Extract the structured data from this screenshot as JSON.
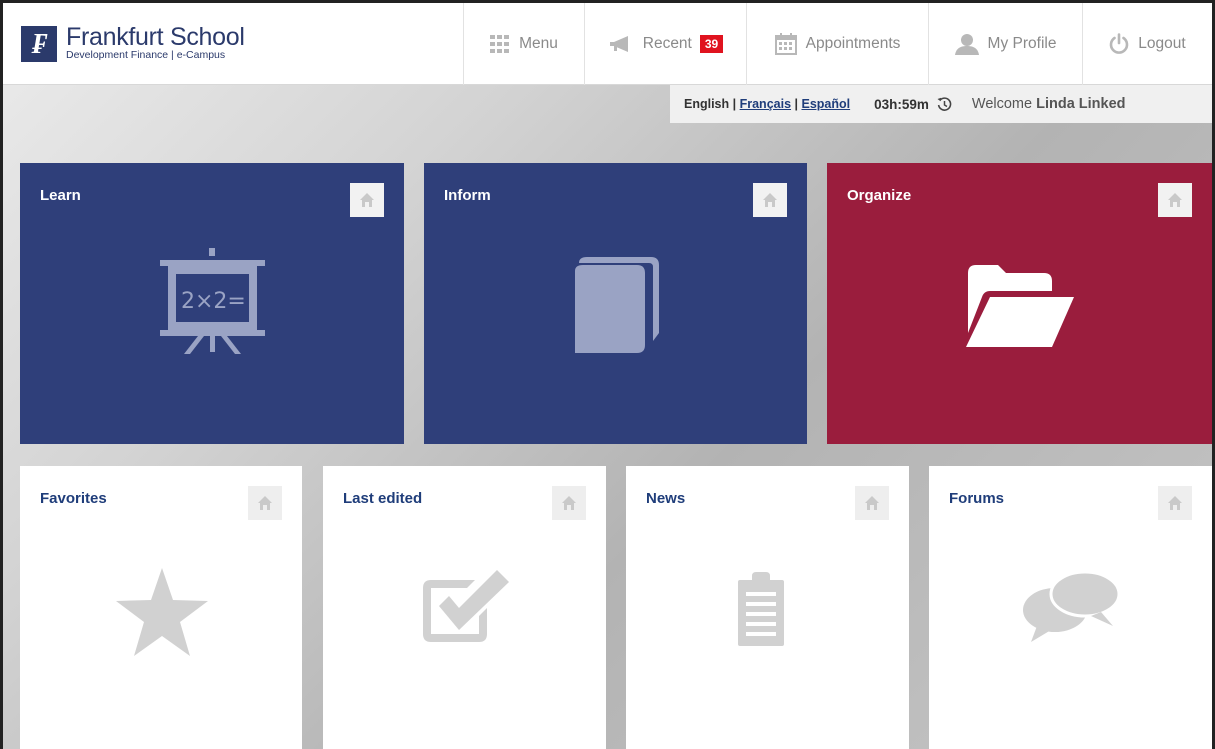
{
  "brand": {
    "name": "Frankfurt School",
    "subtitle": "Development Finance | e-Campus",
    "color": "#2b3a6b"
  },
  "nav": {
    "menu": "Menu",
    "recent": "Recent",
    "recent_count": "39",
    "appointments": "Appointments",
    "profile": "My Profile",
    "logout": "Logout"
  },
  "infobar": {
    "lang_english": "English",
    "lang_francais": "Français",
    "lang_espanol": "Español",
    "timer": "03h:59m",
    "welcome_prefix": "Welcome",
    "user_name": "Linda Linked"
  },
  "tiles": {
    "learn": {
      "title": "Learn",
      "color": "#2f3f7a"
    },
    "inform": {
      "title": "Inform",
      "color": "#2f3f7a"
    },
    "organize": {
      "title": "Organize",
      "color": "#9a1d3d"
    },
    "favorites": {
      "title": "Favorites"
    },
    "last_edited": {
      "title": "Last edited"
    },
    "news": {
      "title": "News"
    },
    "forums": {
      "title": "Forums"
    }
  },
  "icons": [
    "menu-grid-icon",
    "megaphone-icon",
    "calendar-icon",
    "user-icon",
    "power-icon",
    "clock-icon",
    "home-icon",
    "blackboard-icon",
    "book-icon",
    "folder-icon",
    "star-icon",
    "checkbox-icon",
    "clipboard-icon",
    "chat-bubbles-icon"
  ]
}
